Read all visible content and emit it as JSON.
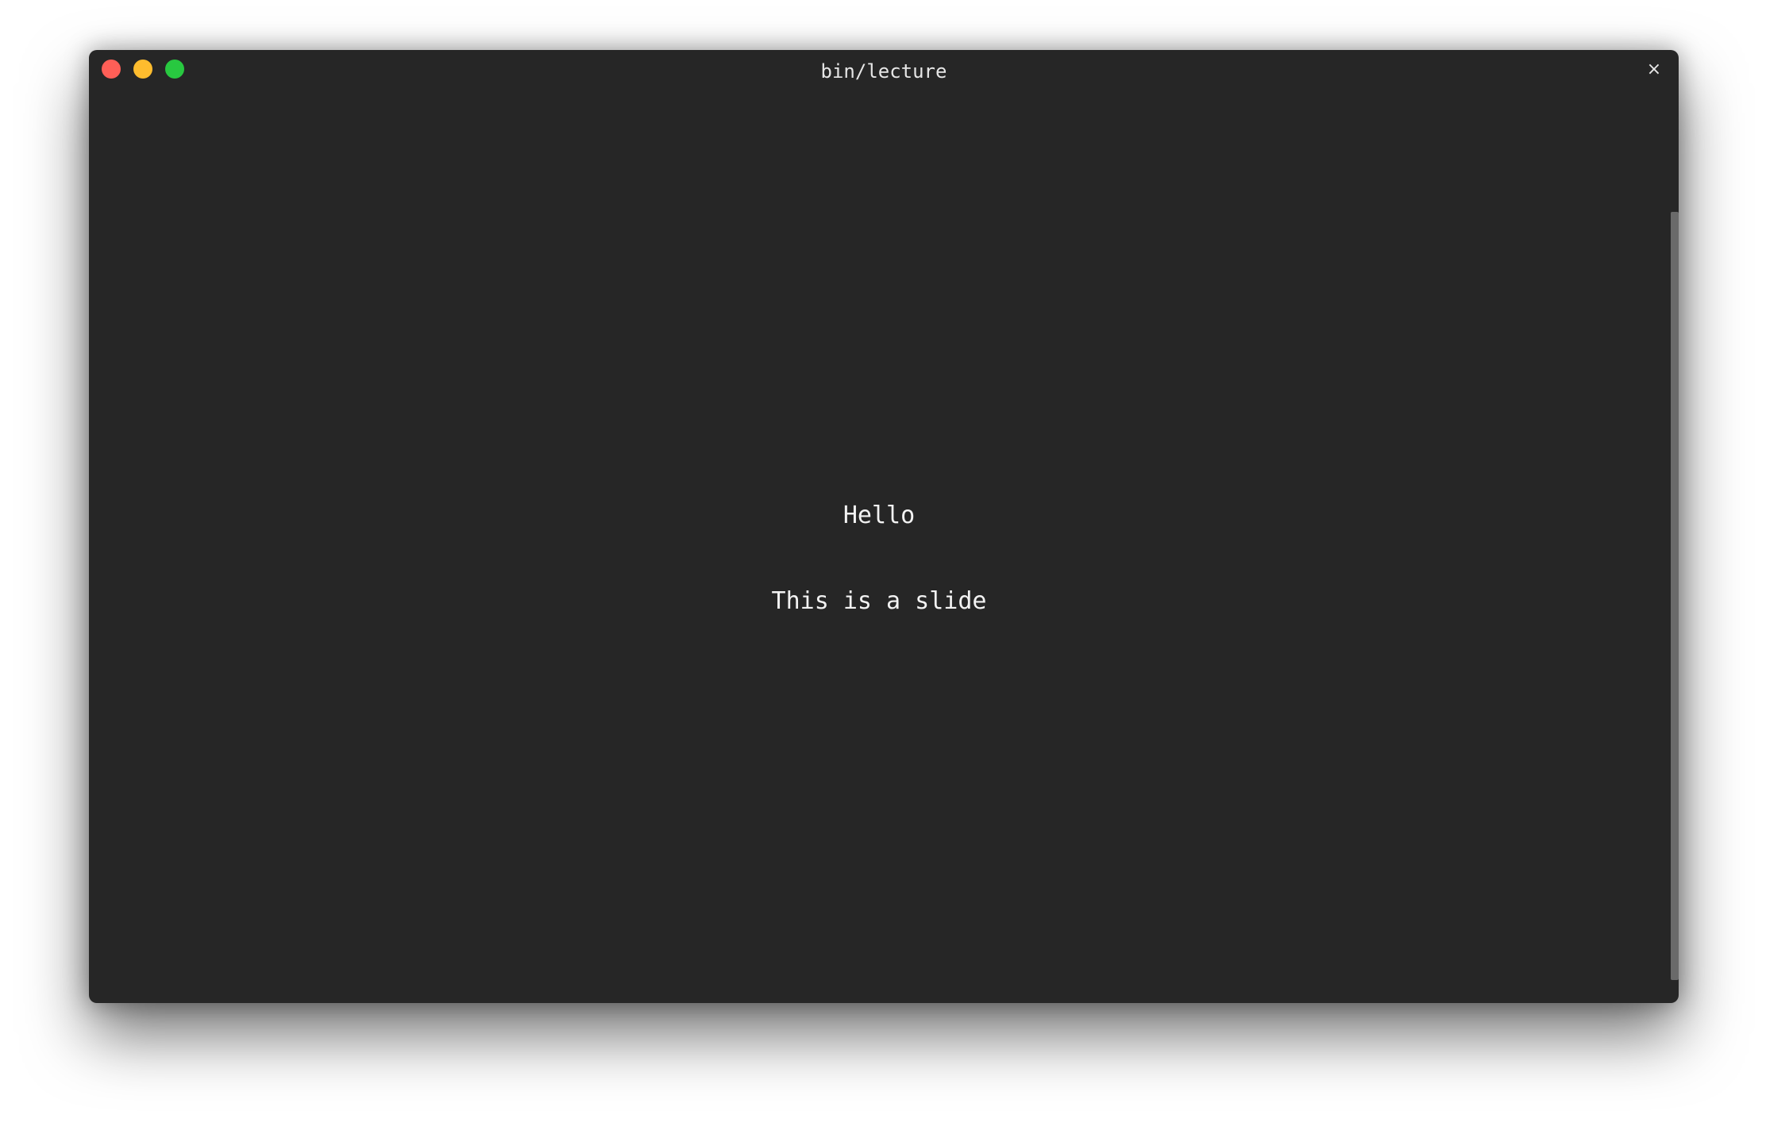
{
  "window": {
    "title": "bin/lecture",
    "close_tab_glyph": "×",
    "background_color": "#262626"
  },
  "traffic_lights": {
    "close_color": "#ff5f57",
    "minimize_color": "#febc2e",
    "maximize_color": "#28c840"
  },
  "slide": {
    "heading": "Hello",
    "body": "This is a slide"
  },
  "terminal": {
    "cursor_color": "#8c8f99",
    "scrollbar_thumb_color": "#6a6a6a"
  }
}
